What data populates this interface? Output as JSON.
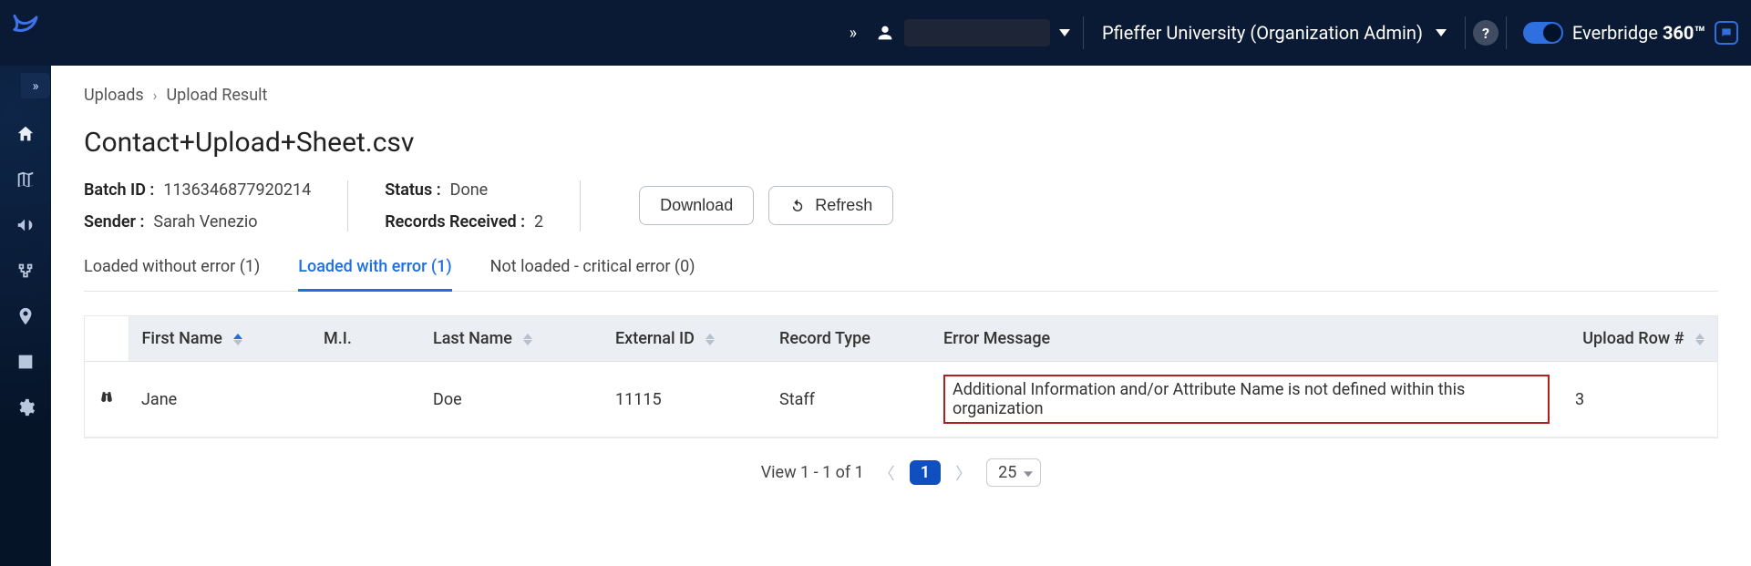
{
  "header": {
    "org_label": "Pfieffer University (Organization Admin)",
    "brand_prefix": "Everbridge",
    "brand_suffix": "360™"
  },
  "sidebar": {
    "items": [
      {
        "name": "home",
        "label": "Home"
      },
      {
        "name": "map",
        "label": "Map"
      },
      {
        "name": "announce",
        "label": "Announce"
      },
      {
        "name": "workflow",
        "label": "Workflow"
      },
      {
        "name": "location",
        "label": "Location"
      },
      {
        "name": "reports",
        "label": "Reports"
      },
      {
        "name": "settings",
        "label": "Settings"
      }
    ]
  },
  "breadcrumb": {
    "root": "Uploads",
    "current": "Upload Result"
  },
  "page": {
    "title": "Contact+Upload+Sheet.csv",
    "batch_id_label": "Batch ID :",
    "batch_id": "1136346877920214",
    "sender_label": "Sender :",
    "sender": "Sarah Venezio",
    "status_label": "Status :",
    "status": "Done",
    "records_label": "Records Received :",
    "records": "2",
    "download_label": "Download",
    "refresh_label": "Refresh"
  },
  "tabs": {
    "without_error": "Loaded without error (1)",
    "with_error": "Loaded with error (1)",
    "not_loaded": "Not loaded - critical error (0)"
  },
  "table": {
    "columns": {
      "first_name": "First Name",
      "mi": "M.I.",
      "last_name": "Last Name",
      "external_id": "External ID",
      "record_type": "Record Type",
      "error_message": "Error Message",
      "upload_row": "Upload Row #"
    },
    "rows": [
      {
        "first_name": "Jane",
        "mi": "",
        "last_name": "Doe",
        "external_id": "11115",
        "record_type": "Staff",
        "error_message": "Additional Information and/or Attribute Name is not defined within this organization",
        "upload_row": "3"
      }
    ]
  },
  "pager": {
    "view_text": "View 1 - 1 of 1",
    "current_page": "1",
    "page_size": "25"
  }
}
